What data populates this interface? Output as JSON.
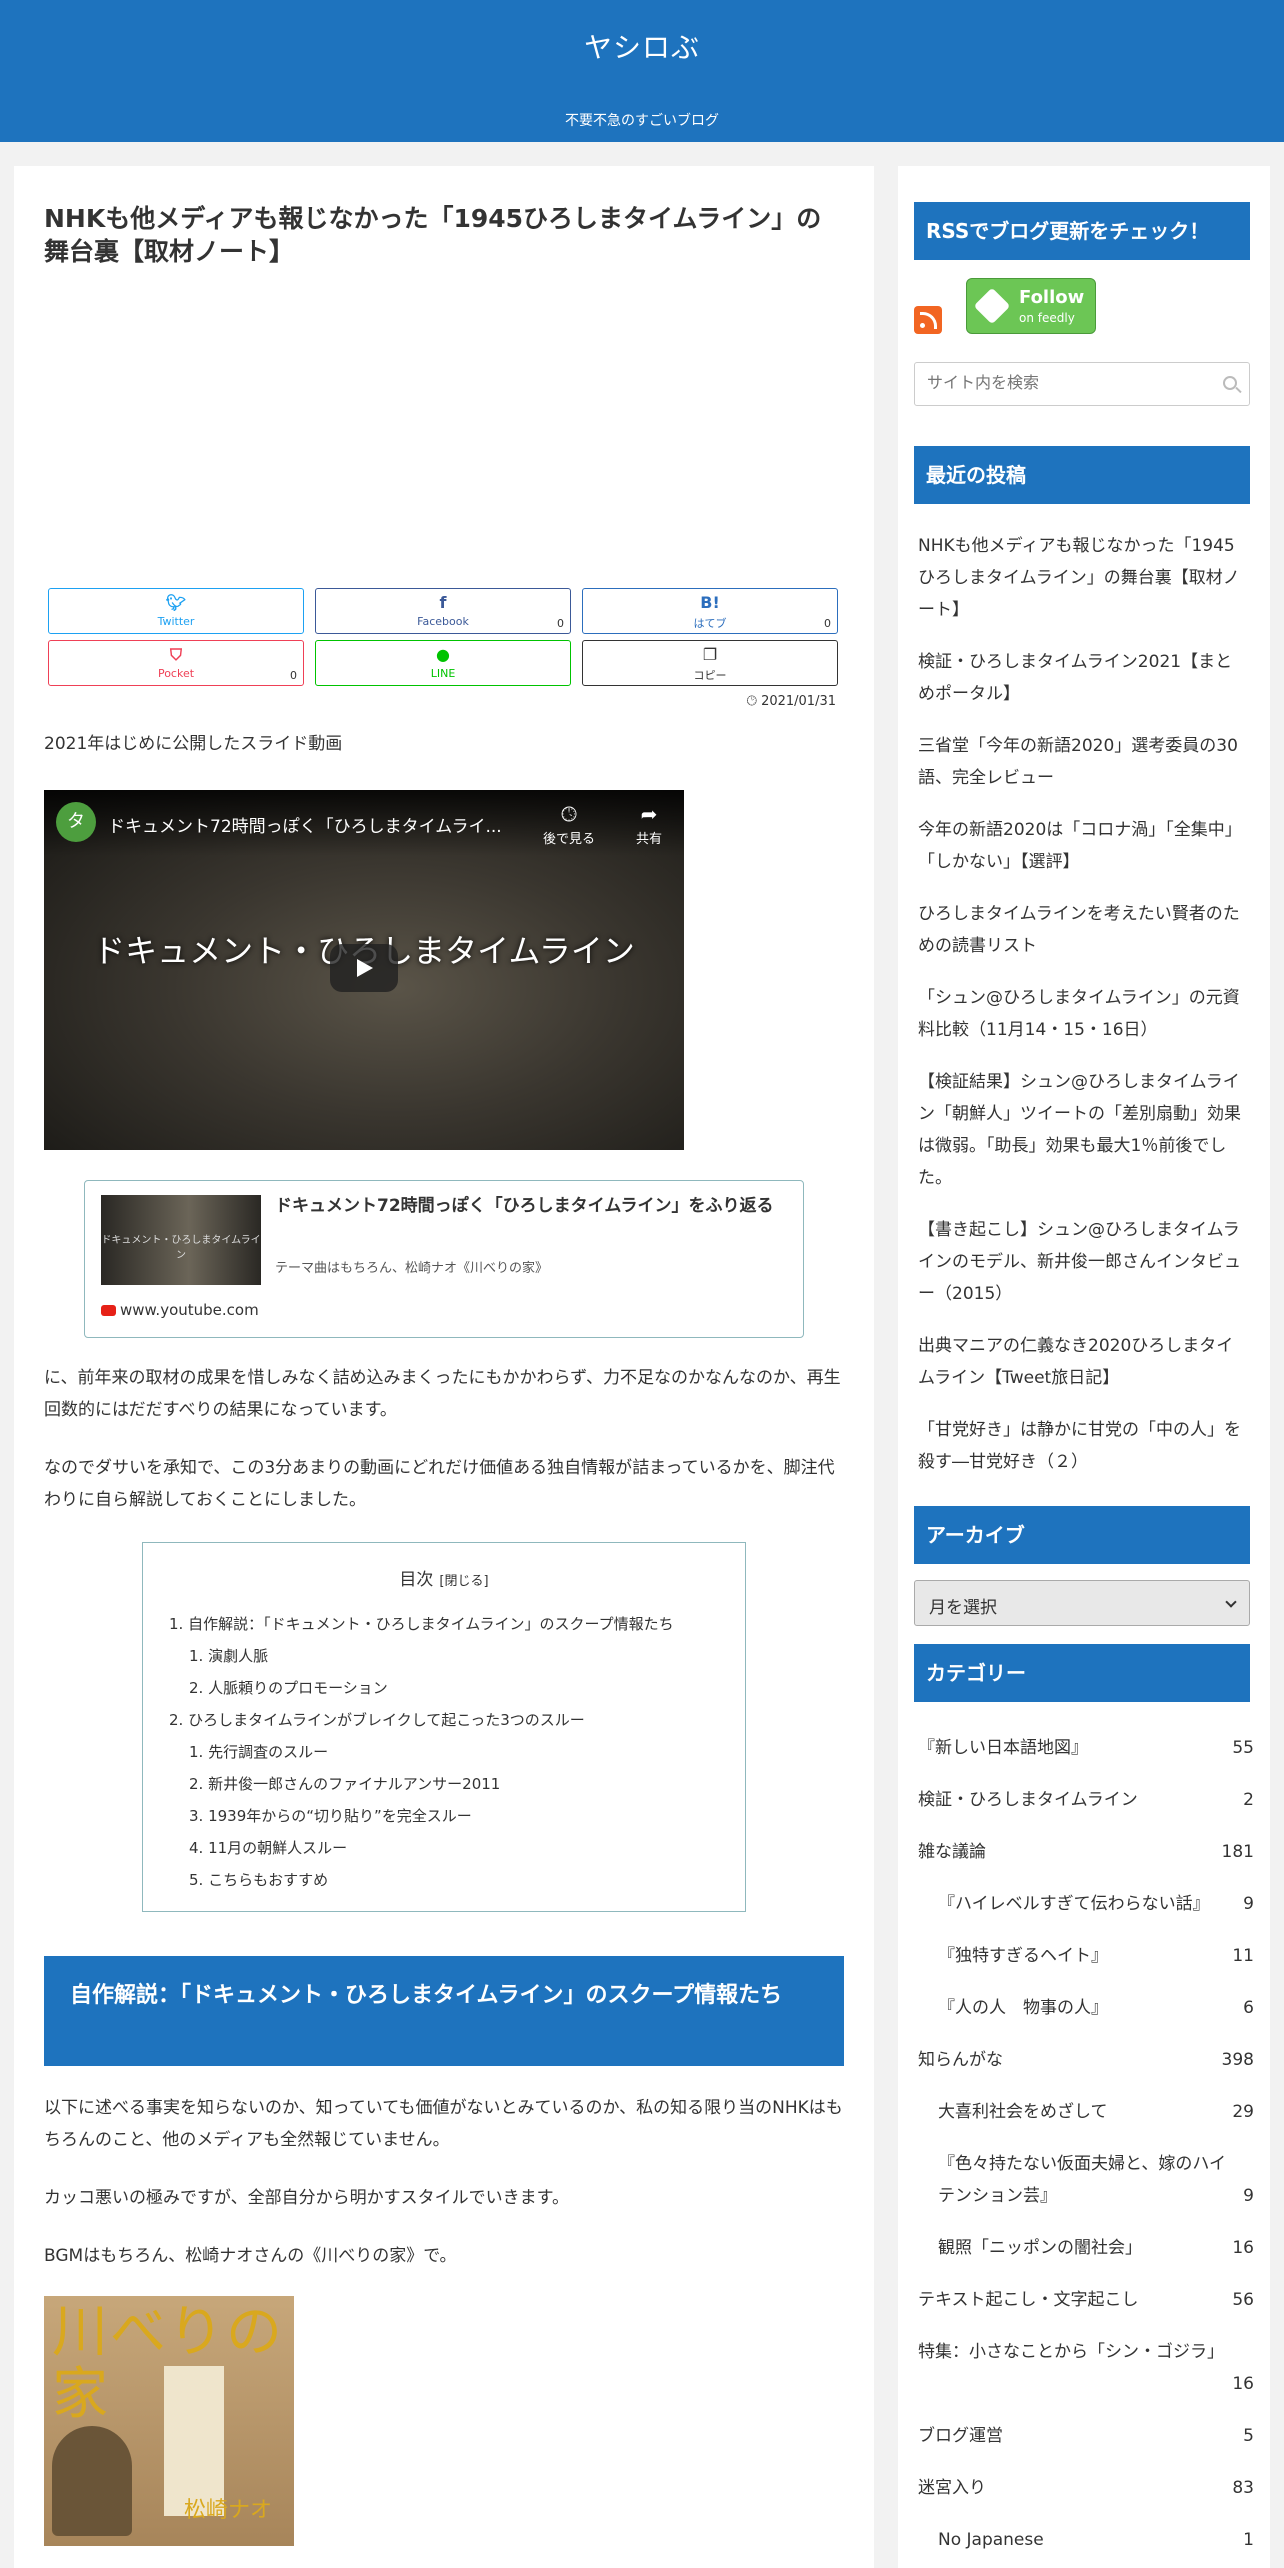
{
  "header": {
    "title": "ヤシロぶ",
    "tagline": "不要不急のすごいブログ"
  },
  "article": {
    "title": "NHKも他メディアも報じなかった「1945ひろしまタイムライン」の舞台裏【取材ノート】",
    "share": {
      "twitter": {
        "label": "Twitter",
        "icon": "twitter-icon"
      },
      "facebook": {
        "label": "Facebook",
        "count": "0",
        "icon": "facebook-icon"
      },
      "hatena": {
        "label": "はてブ",
        "count": "0",
        "icon": "hatena-icon"
      },
      "pocket": {
        "label": "Pocket",
        "count": "0",
        "icon": "pocket-icon"
      },
      "line": {
        "label": "LINE",
        "icon": "line-icon"
      },
      "copy": {
        "label": "コピー",
        "icon": "copy-icon"
      }
    },
    "date": "2021/01/31",
    "intro": "2021年はじめに公開したスライド動画",
    "video": {
      "channel_initial": "タ",
      "title": "ドキュメント72時間っぽく「ひろしまタイムライ...",
      "watch_later": "後で見る",
      "share": "共有",
      "overlay_text": "ドキュメント・ひろしまタイムライン"
    },
    "card": {
      "thumb_text": "ドキュメント・ひろしまタイムライン",
      "title": "ドキュメント72時間っぽく「ひろしまタイムライン」をふり返る",
      "desc": "テーマ曲はもちろん、松崎ナオ《川べりの家》",
      "source": "www.youtube.com"
    },
    "para1": "に、前年来の取材の成果を惜しみなく詰め込みまくったにもかかわらず、力不足なのかなんなのか、再生回数的にはだだすべりの結果になっています。",
    "para2": "なのでダサいを承知で、この3分あまりの動画にどれだけ価値ある独自情報が詰まっているかを、脚注代わりに自ら解説しておくことにしました。",
    "toc": {
      "title": "目次",
      "toggle": "[閉じる]",
      "items": [
        "1. 自作解説：「ドキュメント・ひろしまタイムライン」のスクープ情報たち",
        "1. 演劇人脈",
        "2. 人脈頼りのプロモーション",
        "2. ひろしまタイムラインがブレイクして起こった3つのスルー",
        "1. 先行調査のスルー",
        "2. 新井俊一郎さんのファイナルアンサー2011",
        "3. 1939年からの“切り貼り”を完全スルー",
        "4. 11月の朝鮮人スルー",
        "5. こちらもおすすめ"
      ]
    },
    "heading": "自作解説：「ドキュメント・ひろしまタイムライン」のスクープ情報たち",
    "para3": "以下に述べる事実を知らないのか、知っていても価値がないとみているのか、私の知る限り当のNHKはもちろんのこと、他のメディアも全然報じていません。",
    "para4": "カッコ悪いの極みですが、全部自分から明かすスタイルでいきます。",
    "para5": "BGMはもちろん、松崎ナオさんの《川べりの家》で。",
    "album": {
      "title": "川べりの家",
      "artist": "松崎ナオ"
    }
  },
  "sidebar": {
    "rss_title": "RSSでブログ更新をチェック！",
    "feedly": {
      "line1": "Follow",
      "line2": "on feedly"
    },
    "search_placeholder": "サイト内を検索",
    "recent_title": "最近の投稿",
    "recent": [
      "NHKも他メディアも報じなかった「1945ひろしまタイムライン」の舞台裏【取材ノート】",
      "検証・ひろしまタイムライン2021【まとめポータル】",
      "三省堂「今年の新語2020」選考委員の30語、完全レビュー",
      "今年の新語2020は「コロナ渦」「全集中」「しかない」【選評】",
      "ひろしまタイムラインを考えたい賢者のための読書リスト",
      "「シュン@ひろしまタイムライン」の元資料比較（11月14・15・16日）",
      "【検証結果】シュン@ひろしまタイムライン「朝鮮人」ツイートの「差別扇動」効果は微弱。「助長」効果も最大1％前後でした。",
      "【書き起こし】シュン@ひろしまタイムラインのモデル、新井俊一郎さんインタビュー（2015）",
      "出典マニアの仁義なき2020ひろしまタイムライン【Tweet旅日記】",
      "「甘党好き」は静かに甘党の「中の人」を殺す―甘党好き（２）"
    ],
    "archive_title": "アーカイブ",
    "archive_select": "月を選択",
    "category_title": "カテゴリー",
    "categories": [
      {
        "name": "『新しい日本語地図』",
        "count": "55"
      },
      {
        "name": "検証・ひろしまタイムライン",
        "count": "2"
      },
      {
        "name": "雑な議論",
        "count": "181"
      },
      {
        "name": "『ハイレベルすぎて伝わらない話』",
        "count": "9"
      },
      {
        "name": "『独特すぎるヘイト』",
        "count": "11"
      },
      {
        "name": "『人の人　物事の人』",
        "count": "6"
      },
      {
        "name": "知らんがな",
        "count": "398"
      },
      {
        "name": "大喜利社会をめざして",
        "count": "29"
      },
      {
        "name": "『色々持たない仮面夫婦と、嫁のハイテンション芸』",
        "count": "9"
      },
      {
        "name": "観照「ニッポンの闇社会」",
        "count": "16"
      },
      {
        "name": "テキスト起こし・文字起こし",
        "count": "56"
      },
      {
        "name": "特集：小さなことから「シン・ゴジラ」",
        "count": "16"
      },
      {
        "name": "ブログ運営",
        "count": "5"
      },
      {
        "name": "迷宮入り",
        "count": "83"
      },
      {
        "name": "No Japanese",
        "count": "1"
      }
    ]
  },
  "colors": {
    "brand": "#1e73be",
    "background": "#f2f2f2"
  }
}
